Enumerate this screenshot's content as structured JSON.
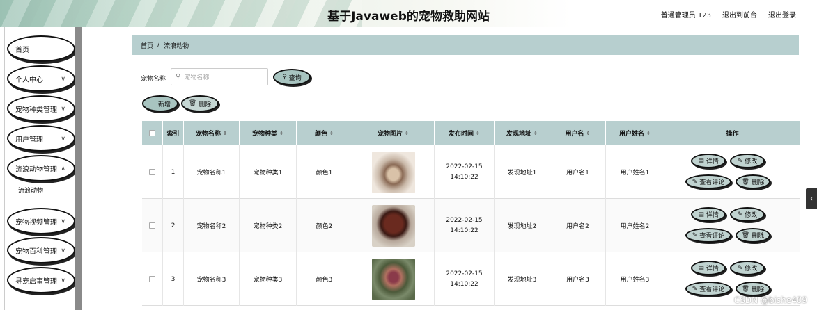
{
  "header": {
    "title": "基于Javaweb的宠物救助网站",
    "user": "普通管理员 123",
    "exit_front": "退出到前台",
    "logout": "退出登录"
  },
  "sidebar": {
    "items": [
      {
        "label": "首页",
        "has_arrow": false
      },
      {
        "label": "个人中心",
        "has_arrow": true
      },
      {
        "label": "宠物种类管理",
        "has_arrow": true
      },
      {
        "label": "用户管理",
        "has_arrow": true
      },
      {
        "label": "流浪动物管理",
        "has_arrow": true
      },
      {
        "label": "宠物视频管理",
        "has_arrow": true
      },
      {
        "label": "宠物百科管理",
        "has_arrow": true
      },
      {
        "label": "寻宠启事管理",
        "has_arrow": true
      }
    ],
    "submenu_label": "流浪动物"
  },
  "breadcrumb": {
    "home": "首页",
    "separator": "/",
    "current": "流浪动物"
  },
  "search": {
    "label": "宠物名称",
    "placeholder": "宠物名称",
    "button": "查询"
  },
  "toolbar": {
    "add": "新增",
    "delete": "删除"
  },
  "table": {
    "headers": {
      "index": "索引",
      "name": "宠物名称",
      "type": "宠物种类",
      "color": "颜色",
      "image": "宠物图片",
      "time": "发布时间",
      "location": "发现地址",
      "username": "用户名",
      "realname": "用户姓名",
      "actions": "操作"
    },
    "rows": [
      {
        "index": "1",
        "name": "宠物名称1",
        "type": "宠物种类1",
        "color": "颜色1",
        "time": "2022-02-15 14:10:22",
        "location": "发现地址1",
        "username": "用户名1",
        "realname": "用户姓名1"
      },
      {
        "index": "2",
        "name": "宠物名称2",
        "type": "宠物种类2",
        "color": "颜色2",
        "time": "2022-02-15 14:10:22",
        "location": "发现地址2",
        "username": "用户名2",
        "realname": "用户姓名2"
      },
      {
        "index": "3",
        "name": "宠物名称3",
        "type": "宠物种类3",
        "color": "颜色3",
        "time": "2022-02-15 14:10:22",
        "location": "发现地址3",
        "username": "用户名3",
        "realname": "用户姓名3"
      }
    ],
    "actions": {
      "detail": "详情",
      "edit": "修改",
      "comments": "查看评论",
      "delete": "删除"
    }
  },
  "watermark": "CSDN @bishe409",
  "colors": {
    "accent": "#b7cfcf",
    "button": "#a8c4c0"
  }
}
